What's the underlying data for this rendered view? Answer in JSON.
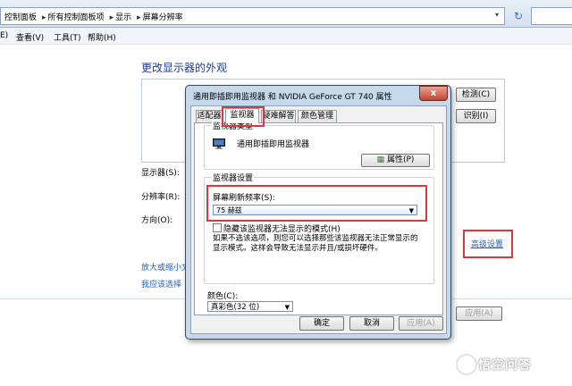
{
  "address_bar": {
    "crumbs": [
      "控制面板",
      "所有控制面板项",
      "显示",
      "屏幕分辨率"
    ],
    "separator": "▸",
    "dropdown_glyph": "▾",
    "refresh_icon": "refresh-icon"
  },
  "menu": {
    "items": [
      "E)",
      "查看(V)",
      "工具(T)",
      "帮助(H)"
    ]
  },
  "page": {
    "heading": "更改显示器的外观",
    "detect_label": "检测(C)",
    "identify_label": "识别(I)",
    "display_label": "显示器(S):",
    "resolution_label": "分辨率(R):",
    "orientation_label": "方向(O):",
    "advanced_link": "高级设置",
    "size_link": "放大或缩小文",
    "settings_link": "我应该选择",
    "apply_label": "应用(A)"
  },
  "dialog": {
    "title": "通用即插即用监视器 和 NVIDIA GeForce GT 740 属性",
    "close_glyph": "x",
    "tabs": [
      "适配器",
      "监视器",
      "疑难解答",
      "颜色管理"
    ],
    "active_tab": "监视器",
    "monitor_type": {
      "title": "监视器类型",
      "name": "通用即插即用监视器",
      "properties_label": "属性(P)"
    },
    "monitor_settings": {
      "title": "监视器设置",
      "refresh_label": "屏幕刷新频率(S):",
      "refresh_value": "75 赫兹",
      "hide_modes_label": "隐藏该监视器无法显示的模式(H)",
      "hide_modes_checked": false,
      "hide_modes_desc_1": "如果不选该选项，则您可以选择那些该监视器无法正常显示的",
      "hide_modes_desc_2": "显示模式。这样会导致无法显示并且/或损坏硬件。"
    },
    "color": {
      "label": "颜色(C):",
      "value": "真彩色(32 位)"
    },
    "buttons": {
      "ok": "确定",
      "cancel": "取消",
      "apply": "应用(A)"
    }
  },
  "watermark": {
    "text": "悟空问答"
  },
  "colors": {
    "highlight": "#d63b3b",
    "link": "#1f5fbf",
    "dialog_frame": "#c6d8ec"
  }
}
